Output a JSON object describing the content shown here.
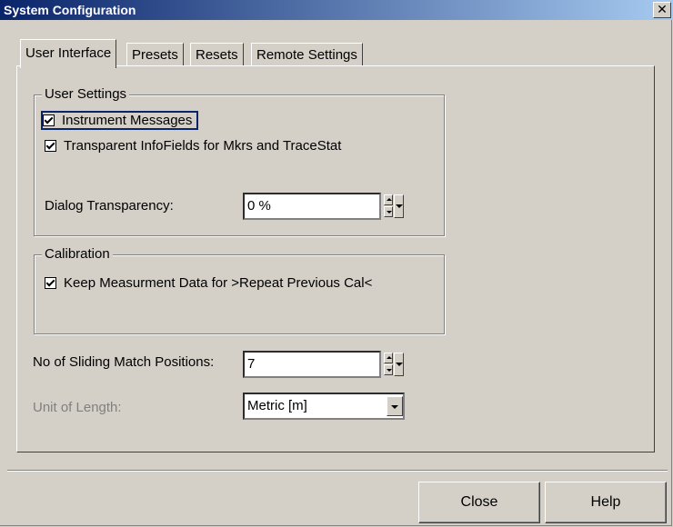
{
  "window": {
    "title": "System Configuration",
    "close_glyph": "✕"
  },
  "tabs": [
    {
      "label": "User Interface",
      "active": true
    },
    {
      "label": "Presets"
    },
    {
      "label": "Resets"
    },
    {
      "label": "Remote Settings"
    }
  ],
  "user_settings": {
    "group_label": "User Settings",
    "instrument_messages": {
      "label": "Instrument Messages",
      "checked": true
    },
    "transparent_infofields": {
      "label": "Transparent InfoFields for Mkrs and TraceStat",
      "checked": true
    },
    "dialog_transparency": {
      "label": "Dialog Transparency:",
      "value": "0 %"
    }
  },
  "calibration": {
    "group_label": "Calibration",
    "keep_measurement": {
      "label": "Keep Measurment Data for >Repeat Previous Cal<",
      "checked": true
    }
  },
  "sliding_match": {
    "label": "No of Sliding Match Positions:",
    "value": "7"
  },
  "unit_of_length": {
    "label": "Unit of Length:",
    "value": "Metric [m]",
    "disabled": true
  },
  "buttons": {
    "close": "Close",
    "help": "Help"
  }
}
